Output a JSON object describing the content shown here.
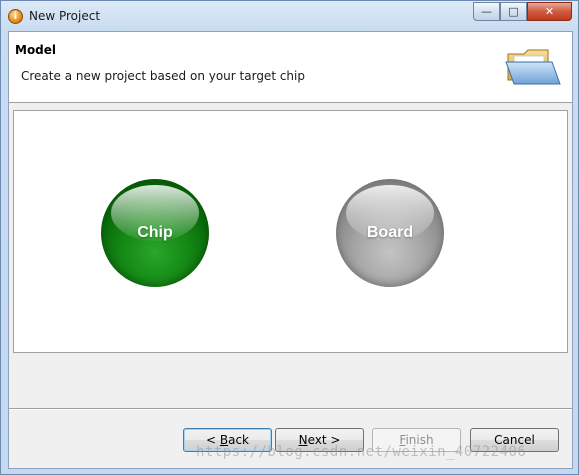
{
  "window": {
    "title": "New Project",
    "title_icon": "info-icon",
    "caption_buttons": {
      "minimize": "minimize-icon",
      "maximize": "maximize-icon",
      "close": "close-icon"
    }
  },
  "header": {
    "title": "Model",
    "description": "Create a new project based on your target chip",
    "icon": "folder-icon"
  },
  "options": {
    "chip_label": "Chip",
    "board_label": "Board",
    "chip_color": "#158a15",
    "board_color": "#a8a8a8"
  },
  "buttons": {
    "back_prefix": "< ",
    "back_mnemonic": "B",
    "back_rest": "ack",
    "next_mnemonic": "N",
    "next_rest": "ext >",
    "finish_mnemonic": "F",
    "finish_rest": "inish",
    "cancel_label": "Cancel"
  },
  "watermark": "https://blog.csdn.net/weixin_40722406"
}
